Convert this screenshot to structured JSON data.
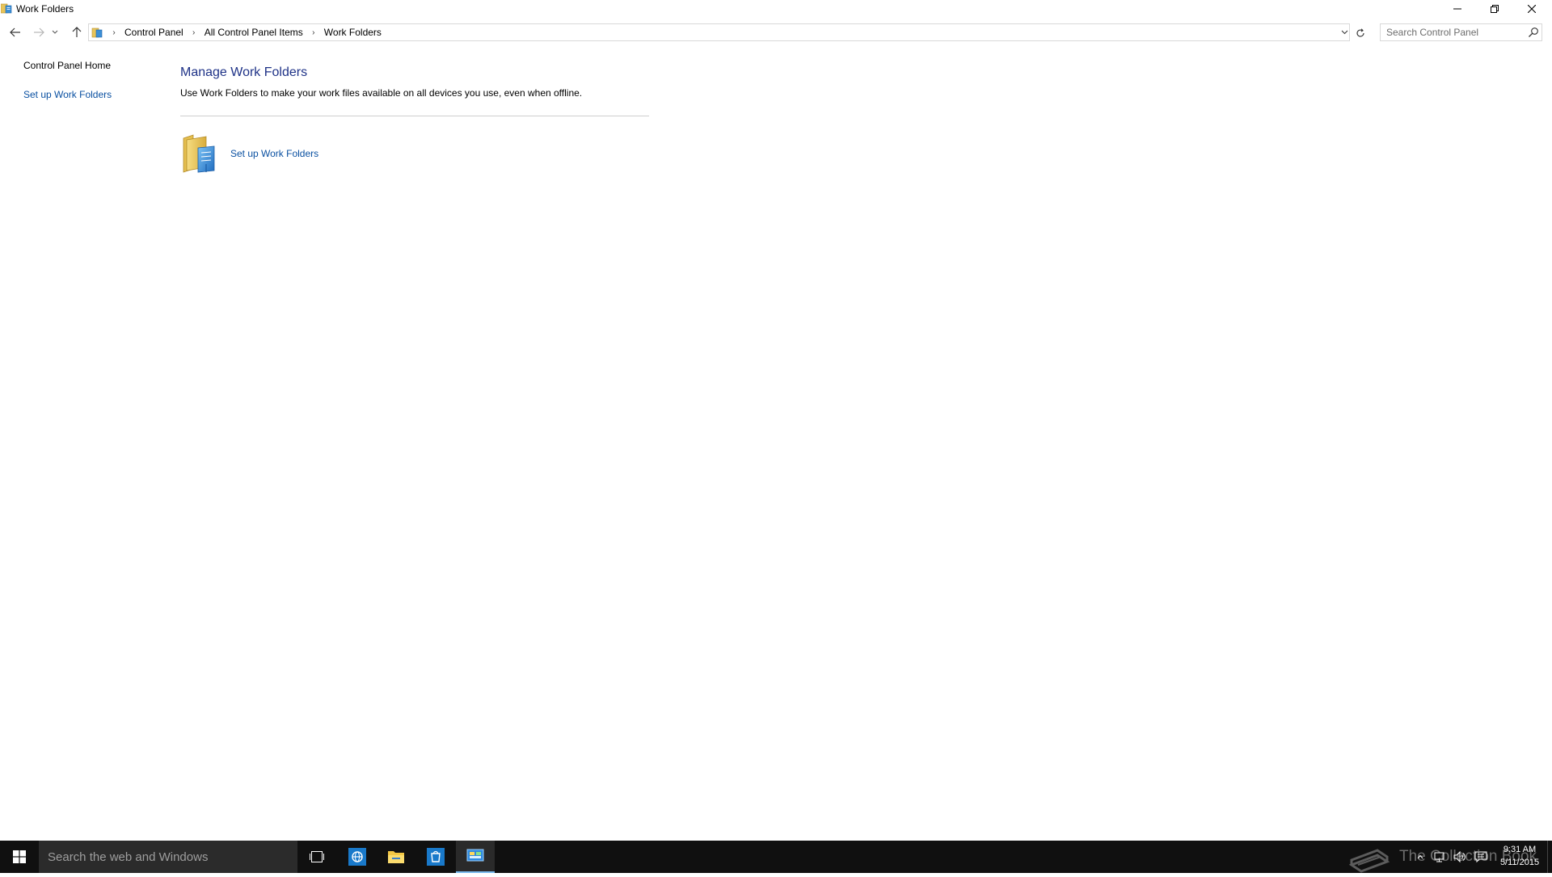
{
  "window": {
    "title": "Work Folders"
  },
  "navigation": {
    "breadcrumbs": [
      "Control Panel",
      "All Control Panel Items",
      "Work Folders"
    ],
    "search_placeholder": "Search Control Panel"
  },
  "left_pane": {
    "home_link": "Control Panel Home",
    "setup_link": "Set up Work Folders"
  },
  "main": {
    "title": "Manage Work Folders",
    "description": "Use Work Folders to make your work files available on all devices you use, even when offline.",
    "task_label": "Set up Work Folders",
    "task_icon": "work-folders-icon"
  },
  "taskbar": {
    "search_placeholder": "Search the web and Windows",
    "watermark": "The Collection Book",
    "time": "9:31 AM",
    "date": "5/11/2015",
    "apps": [
      "task-view-icon",
      "internet-explorer-icon",
      "file-explorer-icon",
      "store-icon",
      "control-panel-icon"
    ]
  },
  "colors": {
    "link": "#0a50a1",
    "heading": "#1e3287",
    "taskbar": "#101010",
    "taskbar_search": "#2b2b2b",
    "active_indicator": "#76b9ed"
  }
}
